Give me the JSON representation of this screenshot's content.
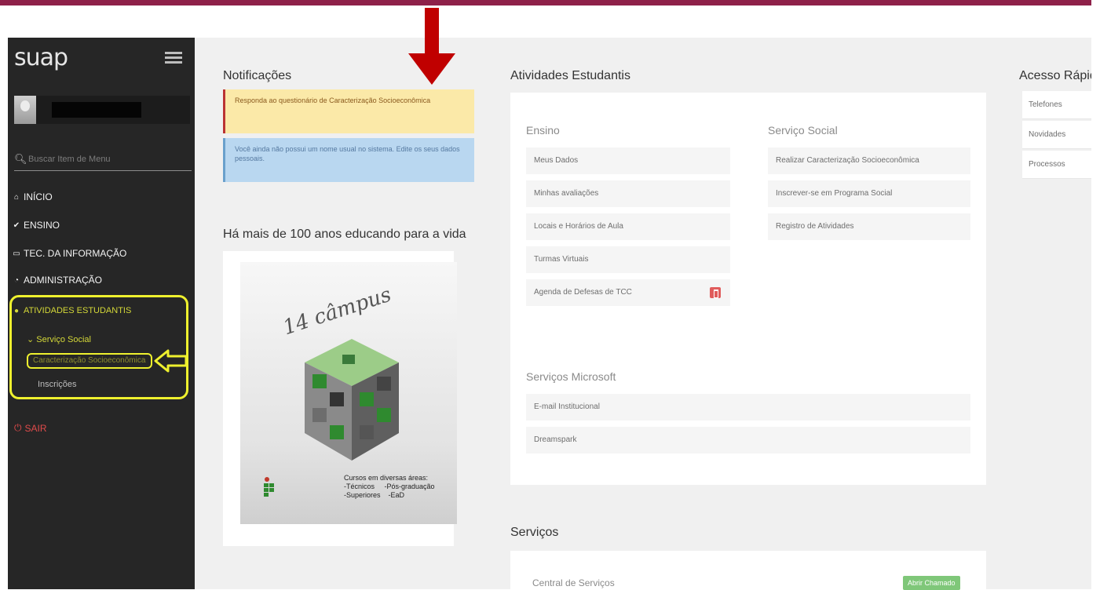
{
  "app": {
    "brand": "suap"
  },
  "sidebar": {
    "search_placeholder": "Buscar Item de Menu",
    "nav": [
      {
        "label": "INÍCIO",
        "icon": "home-icon"
      },
      {
        "label": "ENSINO",
        "icon": "check-circle-icon"
      },
      {
        "label": "TEC. DA INFORMAÇÃO",
        "icon": "monitor-icon"
      },
      {
        "label": "ADMINISTRAÇÃO",
        "icon": "pie-chart-icon"
      },
      {
        "label": "ATIVIDADES ESTUDANTIS",
        "icon": "bulb-icon"
      }
    ],
    "submenu": {
      "label": "Serviço Social",
      "items": [
        "Caracterização Socioeconômica",
        "Inscrições"
      ]
    },
    "logout_label": "SAIR"
  },
  "notifications": {
    "title": "Notificações",
    "items": [
      "Responda ao questionário de Caracterização Socioeconômica",
      "Você ainda não possui um nome usual no sistema. Edite os seus dados pessoais."
    ]
  },
  "banner": {
    "title": "Há mais de 100 anos educando para a vida",
    "campus_text": "14 câmpus",
    "caption": "Cursos em diversas áreas:\n-Técnicos     -Pós-graduação\n-Superiores    -EaD"
  },
  "atividades": {
    "title": "Atividades Estudantis",
    "ensino": {
      "heading": "Ensino",
      "items": [
        "Meus Dados",
        "Minhas avaliações",
        "Locais e Horários de Aula",
        "Turmas Virtuais",
        "Agenda de Defesas de TCC"
      ]
    },
    "servico_social": {
      "heading": "Serviço Social",
      "items": [
        "Realizar Caracterização Socioeconômica",
        "Inscrever-se em Programa Social",
        "Registro de Atividades"
      ]
    },
    "microsoft": {
      "heading": "Serviços Microsoft",
      "items": [
        "E-mail Institucional",
        "Dreamspark"
      ]
    }
  },
  "servicos": {
    "title": "Serviços",
    "central": "Central de Serviços",
    "button": "Abrir Chamado"
  },
  "acesso_rapido": {
    "title": "Acesso Rápido",
    "items": [
      "Telefones",
      "Novidades",
      "Processos"
    ]
  },
  "colors": {
    "topbar": "#8e2149",
    "sidebar": "#262626",
    "highlight": "#eef02e",
    "arrow": "#c00000",
    "warning": "#fbe9a8",
    "info": "#b9d7f0",
    "green": "#7fc779"
  }
}
